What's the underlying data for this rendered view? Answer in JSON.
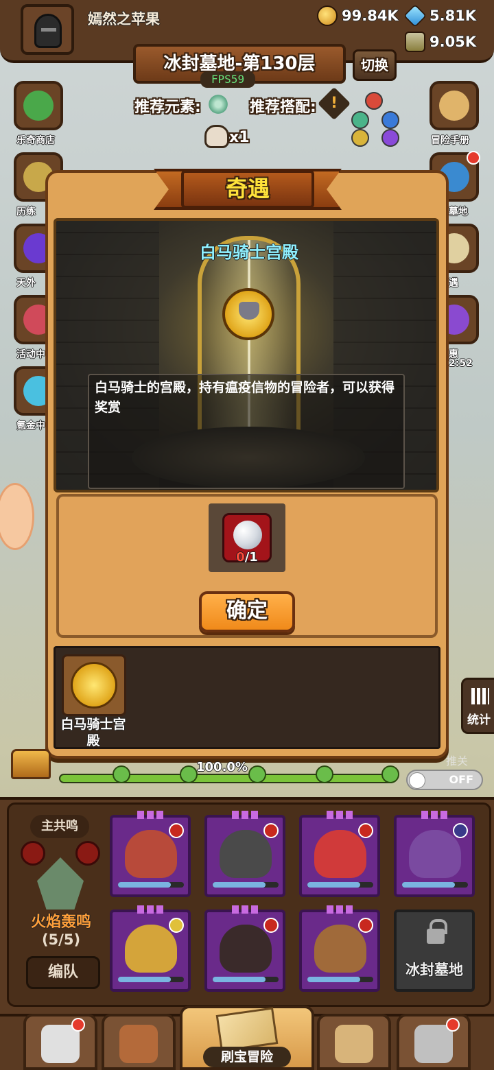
{
  "header": {
    "username": "嫣然之苹果",
    "gold": "99.84K",
    "diamond": "5.81K",
    "potion": "9.05K",
    "stage_title": "冰封墓地-第130层",
    "fps": "FPS59",
    "switch_label": "切换",
    "rec_element_label": "推荐元素:",
    "rec_combo_label": "推荐搭配:",
    "skull_count": "x1"
  },
  "sidebar_left": [
    {
      "label": "乐奇商店"
    },
    {
      "label": "历练"
    },
    {
      "label": "天外"
    },
    {
      "label": "活动中"
    },
    {
      "label": "氪金中"
    }
  ],
  "sidebar_right": [
    {
      "label": "冒险手册"
    },
    {
      "label": "墓地"
    },
    {
      "label": "遇"
    },
    {
      "label": "惠"
    },
    {
      "label": "2:52"
    }
  ],
  "modal": {
    "title": "奇遇",
    "scene_title": "白马骑士宫殿",
    "description": "白马骑士的宫殿，持有瘟疫信物的冒险者，可以获得奖赏",
    "reward_have": "0",
    "reward_need": "/1",
    "confirm_label": "确定",
    "list_items": [
      {
        "label": "白马骑士宫殿"
      }
    ]
  },
  "progress": {
    "text": "100.0%",
    "value": 1.0,
    "toggle_label": "OFF",
    "faded_label": "推关",
    "stats_label": "统计"
  },
  "team": {
    "resonance_label": "主共鸣",
    "team_name": "火焰轰鸣",
    "team_count": "(5/5)",
    "formation_label": "编队",
    "locked_label": "冰封墓地"
  },
  "bottom_nav": {
    "main_label": "刷宝冒险"
  },
  "colors": {
    "accent_title": "#ffe23a",
    "scene_title": "#8ff0ff",
    "confirm_button": "#f08a1a",
    "fps_green": "#67e07a",
    "team_name": "#ff9f3a"
  }
}
